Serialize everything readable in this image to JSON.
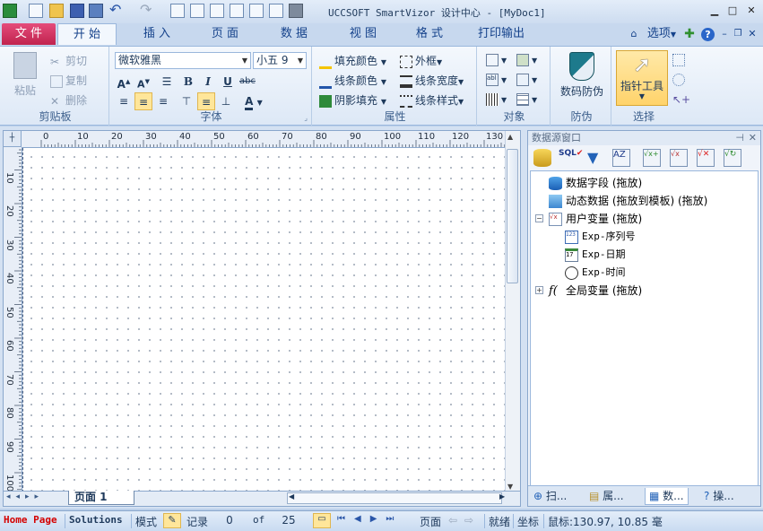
{
  "window": {
    "title": "UCCSOFT SmartVizor 设计中心 - [MyDoc1]"
  },
  "tabs": {
    "file": "文 件",
    "home": "开 始",
    "insert": "插 入",
    "page": "页 面",
    "data": "数 据",
    "view": "视 图",
    "format": "格 式",
    "print": "打印输出",
    "options": "选项"
  },
  "ribbon": {
    "clipboard": {
      "paste": "粘贴",
      "cut": "剪切",
      "copy": "复制",
      "delete": "删除",
      "label": "剪贴板"
    },
    "font": {
      "family": "微软雅黑",
      "size": "小五 9",
      "label": "字体"
    },
    "properties": {
      "fill_color": "填充颜色",
      "line_color": "线条颜色",
      "shadow_fill": "阴影填充",
      "border": "外框",
      "line_width": "线条宽度",
      "line_style": "线条样式",
      "label": "属性"
    },
    "objects": {
      "label": "对象"
    },
    "security": {
      "code_protect": "数码防伪",
      "label": "防伪"
    },
    "select": {
      "pointer_tool": "指针工具",
      "label": "选择"
    }
  },
  "ruler": {
    "h_ticks": [
      "0",
      "10",
      "20",
      "30",
      "40",
      "50",
      "60",
      "70",
      "80",
      "90",
      "100",
      "110",
      "120",
      "130"
    ],
    "v_ticks": [
      "10",
      "20",
      "30",
      "40",
      "50",
      "60",
      "70",
      "80",
      "90",
      "100"
    ]
  },
  "designer": {
    "page_tab": "页面  1"
  },
  "datasource": {
    "title": "数据源窗口",
    "tree": {
      "data_field": "数据字段 (拖放)",
      "dynamic_data": "动态数据 (拖放到模板) (拖放)",
      "user_var": "用户变量 (拖放)",
      "exp_serial": "Exp-序列号",
      "exp_date": "Exp-日期",
      "exp_time": "Exp-时间",
      "global_var": "全局变量 (拖放)"
    },
    "tabs": {
      "scan": "扫...",
      "props": "属...",
      "data": "数...",
      "ops": "操..."
    }
  },
  "status": {
    "home_page": "Home Page",
    "solutions": "Solutions",
    "mode": "模式",
    "record": "记录",
    "record_value": "0",
    "of": "of",
    "total": "25",
    "page": "页面",
    "ready": "就绪",
    "coord": "坐标",
    "mouse": "鼠标:130.97, 10.85 毫"
  },
  "colors": {
    "accent": "#c0234e",
    "ribbon_bg": "#dde8f6",
    "status_red": "#d40000"
  }
}
